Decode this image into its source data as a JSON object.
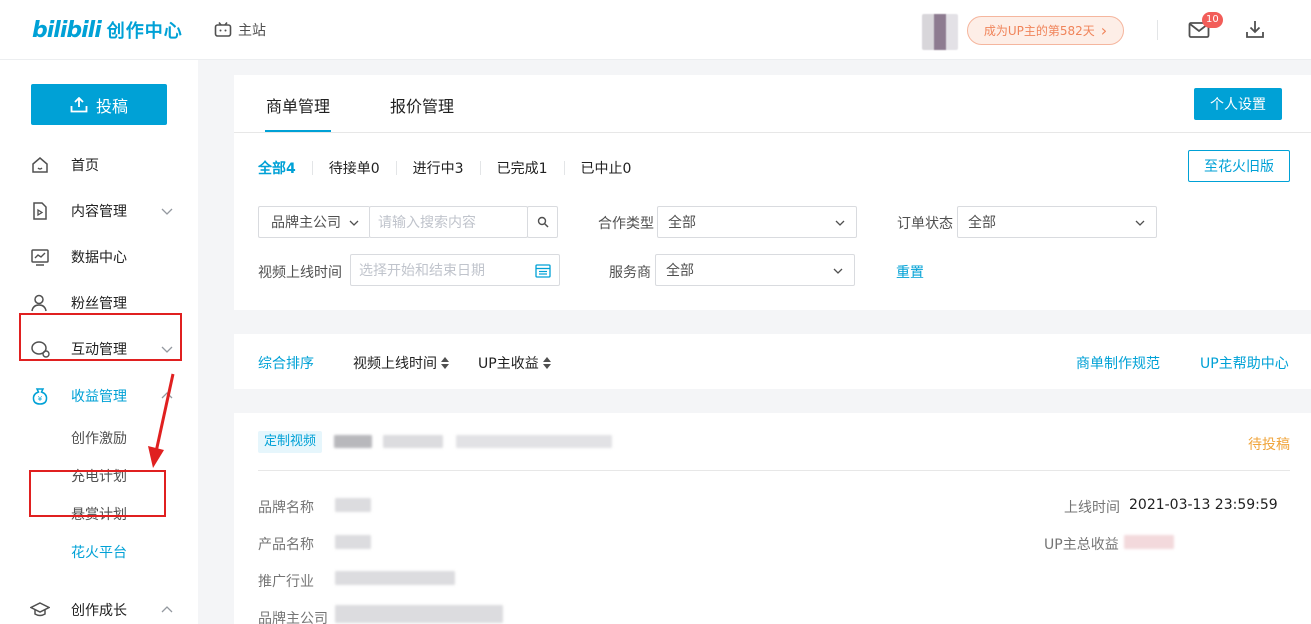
{
  "header": {
    "logo_brand": "bilibili",
    "logo_center": "创作中心",
    "home_label": "主站",
    "up_days_label": "成为UP主的第582天",
    "up_days_chevron": "›",
    "mail_count": "10"
  },
  "sidebar": {
    "upload_label": "投稿",
    "items": [
      {
        "label": "首页"
      },
      {
        "label": "内容管理"
      },
      {
        "label": "数据中心"
      },
      {
        "label": "粉丝管理"
      },
      {
        "label": "互动管理"
      },
      {
        "label": "收益管理"
      },
      {
        "label": "创作成长"
      }
    ],
    "sub_items": [
      {
        "label": "创作激励"
      },
      {
        "label": "充电计划"
      },
      {
        "label": "悬赏计划"
      },
      {
        "label": "花火平台"
      }
    ]
  },
  "main": {
    "tabs": [
      {
        "label": "商单管理"
      },
      {
        "label": "报价管理"
      }
    ],
    "personal_settings_label": "个人设置",
    "old_version_label": "至花火旧版",
    "status_filters": [
      {
        "label": "全部4"
      },
      {
        "label": "待接单0"
      },
      {
        "label": "进行中3"
      },
      {
        "label": "已完成1"
      },
      {
        "label": "已中止0"
      }
    ],
    "search_type_value": "品牌主公司",
    "search_placeholder": "请输入搜索内容",
    "coop_type_label": "合作类型",
    "coop_type_value": "全部",
    "order_status_label": "订单状态",
    "order_status_value": "全部",
    "video_time_label": "视频上线时间",
    "date_placeholder": "选择开始和结束日期",
    "provider_label": "服务商",
    "provider_value": "全部",
    "reset_label": "重置",
    "sort": {
      "comprehensive": "综合排序",
      "video_time": "视频上线时间",
      "up_income": "UP主收益",
      "spec_link": "商单制作规范",
      "help_link": "UP主帮助中心"
    },
    "order": {
      "tag": "定制视频",
      "status": "待投稿",
      "brand_name_label": "品牌名称",
      "product_name_label": "产品名称",
      "industry_label": "推广行业",
      "company_label": "品牌主公司",
      "online_time_label": "上线时间",
      "online_time_value": "2021-03-13 23:59:59",
      "income_label": "UP主总收益"
    }
  },
  "colors": {
    "accent": "#00a1d6",
    "warning": "#f0a53c",
    "annotation_red": "#e02020",
    "badge_red": "#f25d59"
  }
}
